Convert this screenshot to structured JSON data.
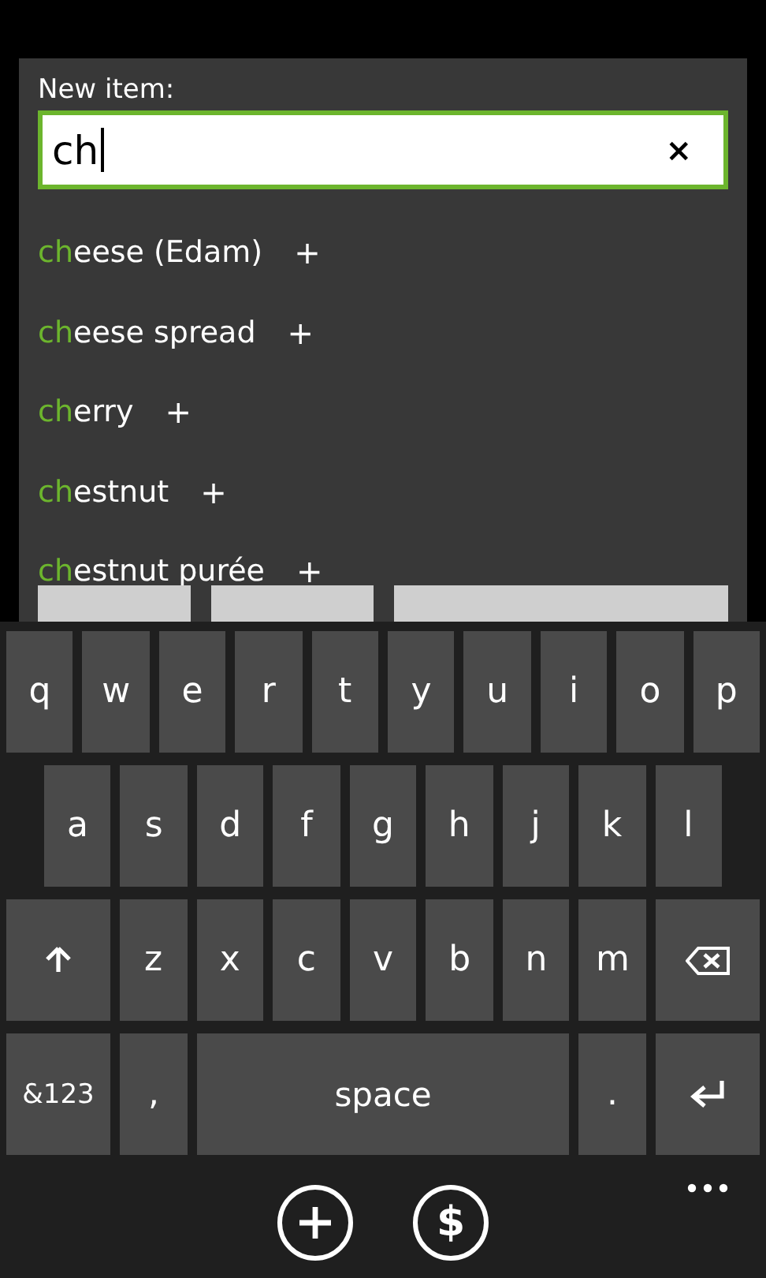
{
  "form": {
    "label": "New item:",
    "field": {
      "value": "ch",
      "clear": "×"
    }
  },
  "suggestions": [
    {
      "match": "ch",
      "rest": "eese (Edam)",
      "add": "+"
    },
    {
      "match": "ch",
      "rest": "eese spread",
      "add": "+"
    },
    {
      "match": "ch",
      "rest": "erry",
      "add": "+"
    },
    {
      "match": "ch",
      "rest": "estnut",
      "add": "+"
    },
    {
      "match": "ch",
      "rest": "estnut purée",
      "add": "+"
    }
  ],
  "hidden_buttons": [
    {
      "kind": "partial"
    },
    {
      "kind": "partial"
    },
    {
      "kind": "partial"
    }
  ],
  "keyboard": [
    [
      {
        "kind": "char",
        "label": "q"
      },
      {
        "kind": "char",
        "label": "w"
      },
      {
        "kind": "char",
        "label": "e"
      },
      {
        "kind": "char",
        "label": "r"
      },
      {
        "kind": "char",
        "label": "t"
      },
      {
        "kind": "char",
        "label": "y"
      },
      {
        "kind": "char",
        "label": "u"
      },
      {
        "kind": "char",
        "label": "i"
      },
      {
        "kind": "char",
        "label": "o"
      },
      {
        "kind": "char",
        "label": "p"
      }
    ],
    [
      {
        "kind": "char",
        "label": "a"
      },
      {
        "kind": "char",
        "label": "s"
      },
      {
        "kind": "char",
        "label": "d"
      },
      {
        "kind": "char",
        "label": "f"
      },
      {
        "kind": "char",
        "label": "g"
      },
      {
        "kind": "char",
        "label": "h"
      },
      {
        "kind": "char",
        "label": "j"
      },
      {
        "kind": "char",
        "label": "k"
      },
      {
        "kind": "char",
        "label": "l"
      }
    ],
    [
      {
        "kind": "shift"
      },
      {
        "kind": "char",
        "label": "z"
      },
      {
        "kind": "char",
        "label": "x"
      },
      {
        "kind": "char",
        "label": "c"
      },
      {
        "kind": "char",
        "label": "v"
      },
      {
        "kind": "char",
        "label": "b"
      },
      {
        "kind": "char",
        "label": "n"
      },
      {
        "kind": "char",
        "label": "m"
      },
      {
        "kind": "backspace"
      }
    ],
    [
      {
        "kind": "mode",
        "label": "&123"
      },
      {
        "kind": "char",
        "label": ","
      },
      {
        "kind": "space",
        "label": "space"
      },
      {
        "kind": "char",
        "label": "."
      },
      {
        "kind": "enter"
      }
    ]
  ],
  "app_bar": {
    "buttons": [
      {
        "kind": "add"
      },
      {
        "kind": "text",
        "label": "$"
      }
    ]
  }
}
